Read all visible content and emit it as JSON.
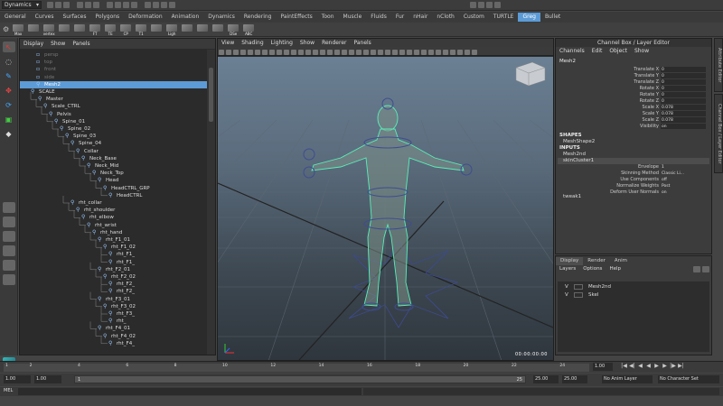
{
  "status_line": {
    "mode": "Dynamics"
  },
  "shelf_tabs": [
    "General",
    "Curves",
    "Surfaces",
    "Polygons",
    "Deformation",
    "Animation",
    "Dynamics",
    "Rendering",
    "PaintEffects",
    "Toon",
    "Muscle",
    "Fluids",
    "Fur",
    "nHair",
    "nCloth",
    "Custom",
    "TURTLE",
    "Greg",
    "Bullet"
  ],
  "shelf_active": "Greg",
  "shelf_buttons": [
    "Max",
    "",
    "vertex",
    "",
    "",
    "FT",
    "TE",
    "CP",
    "T1",
    "",
    "Ligh",
    "",
    "",
    "",
    "DSe",
    "ABC"
  ],
  "outliner": {
    "menu": [
      "Display",
      "Show",
      "Panels"
    ],
    "items": [
      {
        "label": "persp",
        "dim": true
      },
      {
        "label": "top",
        "dim": true
      },
      {
        "label": "front",
        "dim": true
      },
      {
        "label": "side",
        "dim": true
      },
      {
        "label": "Mesh2",
        "sel": true
      },
      {
        "label": "SCALE"
      },
      {
        "label": "Master"
      },
      {
        "label": "Scale_CTRL"
      },
      {
        "label": "Pelvis"
      },
      {
        "label": "Spine_01"
      },
      {
        "label": "Spine_02"
      },
      {
        "label": "Spine_03"
      },
      {
        "label": "Spine_04"
      },
      {
        "label": "Collar"
      },
      {
        "label": "Neck_Base"
      },
      {
        "label": "Neck_Mid"
      },
      {
        "label": "Neck_Top"
      },
      {
        "label": "Head"
      },
      {
        "label": "HeadCTRL_GRP"
      },
      {
        "label": "HeadCTRL"
      },
      {
        "label": "rht_collar"
      },
      {
        "label": "rht_shoulder"
      },
      {
        "label": "rht_elbow"
      },
      {
        "label": "rht_wrist"
      },
      {
        "label": "rht_hand"
      },
      {
        "label": "rht_F1_01"
      },
      {
        "label": "rht_F1_02"
      },
      {
        "label": "rht_F1_"
      },
      {
        "label": "rht_F1_"
      },
      {
        "label": "rht_F2_01"
      },
      {
        "label": "rht_F2_02"
      },
      {
        "label": "rht_F2_"
      },
      {
        "label": "rht_F2_"
      },
      {
        "label": "rht_F3_01"
      },
      {
        "label": "rht_F3_02"
      },
      {
        "label": "rht_F3_"
      },
      {
        "label": "rht_"
      },
      {
        "label": "rht_F4_01"
      },
      {
        "label": "rht_F4_02"
      },
      {
        "label": "rht_F4_"
      }
    ]
  },
  "viewport": {
    "menu": [
      "View",
      "Shading",
      "Lighting",
      "Show",
      "Renderer",
      "Panels"
    ],
    "readout": "00:00:00:00"
  },
  "channel_box": {
    "title": "Channel Box / Layer Editor",
    "menu": [
      "Channels",
      "Edit",
      "Object",
      "Show"
    ],
    "object": "Mesh2",
    "attributes": [
      {
        "name": "Translate X",
        "value": "0"
      },
      {
        "name": "Translate Y",
        "value": "0"
      },
      {
        "name": "Translate Z",
        "value": "0"
      },
      {
        "name": "Rotate X",
        "value": "0"
      },
      {
        "name": "Rotate Y",
        "value": "0"
      },
      {
        "name": "Rotate Z",
        "value": "0"
      },
      {
        "name": "Scale X",
        "value": "0.078"
      },
      {
        "name": "Scale Y",
        "value": "0.078"
      },
      {
        "name": "Scale Z",
        "value": "0.078"
      },
      {
        "name": "Visibility",
        "value": "on"
      }
    ],
    "shapes_label": "SHAPES",
    "shape_name": "MeshShape2",
    "inputs_label": "INPUTS",
    "inputs": [
      "Mesh2nd",
      "skinCluster1"
    ],
    "skin_attrs": [
      {
        "name": "Envelope",
        "value": "1"
      },
      {
        "name": "Skinning Method",
        "value": "Classic Li..."
      },
      {
        "name": "Use Components",
        "value": "off"
      },
      {
        "name": "Normalize Weights",
        "value": "Post"
      },
      {
        "name": "Deform User Normals",
        "value": "on"
      }
    ],
    "tweak": "tweak1",
    "side_tabs": [
      "Attribute Editor",
      "Channel Box / Layer Editor"
    ]
  },
  "layer_editor": {
    "tabs": [
      "Display",
      "Render",
      "Anim"
    ],
    "menu": [
      "Layers",
      "Options",
      "Help"
    ],
    "layers": [
      {
        "v": "V",
        "name": "Mesh2nd"
      },
      {
        "v": "V",
        "name": "Skel"
      }
    ]
  },
  "time_slider": {
    "ticks": [
      "1",
      "2",
      "4",
      "6",
      "8",
      "10",
      "12",
      "14",
      "16",
      "18",
      "20",
      "22",
      "24"
    ],
    "current": "1.00",
    "playback": [
      "|◀",
      "◀|",
      "◀",
      "◀",
      "▶",
      "▶",
      "|▶",
      "▶|"
    ]
  },
  "range_slider": {
    "start_field": "1.00",
    "start_field2": "1.00",
    "range_start": "1",
    "range_end": "25",
    "end_field": "25.00",
    "end_field2": "25.00",
    "anim_layer": "No Anim Layer",
    "character_set": "No Character Set"
  },
  "command_line": {
    "label": "MEL"
  }
}
